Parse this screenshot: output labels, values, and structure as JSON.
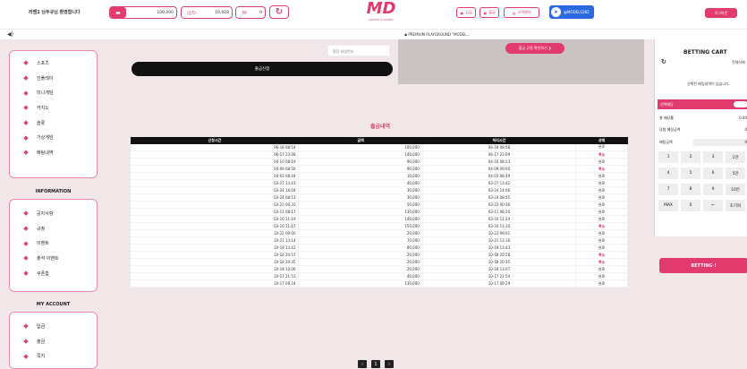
{
  "header": {
    "greeting": "라뱀1 님두규님 환영합니다",
    "wallet_value": "100,000",
    "point_value": "10,918",
    "mail_count": "0",
    "refresh_icon": "refresh-icon",
    "logo_text": "MD",
    "logo_sub": "SPORTS & CASINO",
    "deposit": "입금",
    "withdraw": "출금",
    "support": "고객센터",
    "telegram": "@MODELS282",
    "logout": "로그아웃",
    "accent": "#e23c6f"
  },
  "ticker": {
    "text": "◆ PREMIUM PLAYGROUND \"MODEL..."
  },
  "sidebar": {
    "games": [
      {
        "label": "스포츠",
        "icon": "soccer-icon"
      },
      {
        "label": "인플레이",
        "icon": "live-icon"
      },
      {
        "label": "미니게임",
        "icon": "minigame-icon"
      },
      {
        "label": "카지노",
        "icon": "casino-icon"
      },
      {
        "label": "슬롯",
        "icon": "slot-icon"
      },
      {
        "label": "가상게임",
        "icon": "virtual-icon"
      },
      {
        "label": "배팅내역",
        "icon": "history-icon"
      }
    ],
    "info_title": "INFORMATION",
    "info": [
      {
        "label": "공지사항",
        "icon": "bell-icon"
      },
      {
        "label": "규정",
        "icon": "document-icon"
      },
      {
        "label": "이벤트",
        "icon": "gift-icon"
      },
      {
        "label": "출석 이벤트",
        "icon": "calendar-icon"
      },
      {
        "label": "쿠폰함",
        "icon": "coupon-icon"
      }
    ],
    "account_title": "MY ACCOUNT",
    "account": [
      {
        "label": "입금",
        "icon": "deposit-icon"
      },
      {
        "label": "출금",
        "icon": "withdraw-icon"
      },
      {
        "label": "쪽지",
        "icon": "message-icon"
      }
    ]
  },
  "withdraw": {
    "password_placeholder": "환전 비밀번호",
    "rules_button": "출금 규정 확인하기 ❯",
    "request_button": "출금신청",
    "history_title": "출금내역",
    "columns": [
      "신청시간",
      "금액",
      "처리시간",
      "상태"
    ],
    "rows": [
      [
        "06-18 08:54",
        "100,000",
        "06-18 08:58",
        "완료"
      ],
      [
        "06-17 23:08",
        "140,000",
        "06-17 23:09",
        "취소"
      ],
      [
        "04-10 08:19",
        "90,000",
        "04-10 08:23",
        "완료"
      ],
      [
        "04-09 08:56",
        "90,000",
        "04-09 09:00",
        "취소"
      ],
      [
        "04-03 08:44",
        "10,000",
        "04-03 08:49",
        "완료"
      ],
      [
        "03-27 13:41",
        "40,000",
        "03-27 13:42",
        "완료"
      ],
      [
        "03-24 14:04",
        "30,000",
        "03-24 14:06",
        "완료"
      ],
      [
        "03-24 08:51",
        "30,000",
        "03-24 08:55",
        "완료"
      ],
      [
        "03-23 00:33",
        "50,000",
        "03-23 00:36",
        "완료"
      ],
      [
        "03-11 08:17",
        "130,000",
        "03-11 08:20",
        "완료"
      ],
      [
        "03-10 11:19",
        "140,000",
        "03-10 11:24",
        "완료"
      ],
      [
        "03-10 11:07",
        "150,000",
        "03-10 11:10",
        "취소"
      ],
      [
        "10-22 09:00",
        "20,000",
        "10-22 09:01",
        "완료"
      ],
      [
        "10-21 13:14",
        "70,000",
        "10-21 13:16",
        "완료"
      ],
      [
        "10-19 13:42",
        "80,000",
        "10-19 13:43",
        "완료"
      ],
      [
        "10-18 20:57",
        "20,000",
        "10-18 20:58",
        "취소"
      ],
      [
        "10-18 20:35",
        "20,000",
        "10-18 20:35",
        "취소"
      ],
      [
        "10-18 13:06",
        "20,000",
        "10-18 13:07",
        "완료"
      ],
      [
        "10-17 21:53",
        "40,000",
        "10-17 21:54",
        "완료"
      ],
      [
        "10-17 09:24",
        "130,000",
        "10-17 09:29",
        "완료"
      ]
    ],
    "cancel_status": "취소",
    "page": "1"
  },
  "cart": {
    "title": "BETTING CART",
    "delete_all": "전체삭제",
    "empty_text": "선택된 배팅내역이 없습니다.",
    "selected_label": "선택배당",
    "total_odds_label": "총 배당률",
    "total_odds": "0.00",
    "expected_label": "당첨 예상금액",
    "expected": "0",
    "bet_amount_label": "배팅금액",
    "bet_amount": "0",
    "keys": [
      "1",
      "2",
      "3",
      "1만",
      "4",
      "5",
      "6",
      "5만",
      "7",
      "8",
      "9",
      "10만",
      "MAX",
      "0",
      "←",
      "초기화"
    ],
    "bet_button": "BETTING !"
  }
}
